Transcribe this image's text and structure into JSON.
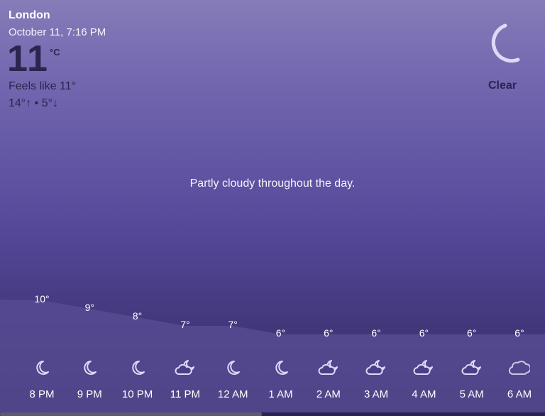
{
  "header": {
    "location": "London",
    "datetime": "October 11, 7:16 PM",
    "temperature": "11",
    "unit": "°C",
    "feels_like": "Feels like 11°",
    "high_low": "14°↑ • 5°↓"
  },
  "condition": {
    "label": "Clear",
    "icon": "crescent-moon-icon"
  },
  "summary": "Partly cloudy throughout the day.",
  "hourly": [
    {
      "time": "8 PM",
      "temp": "10°",
      "value": 10,
      "icon": "moon"
    },
    {
      "time": "9 PM",
      "temp": "9°",
      "value": 9,
      "icon": "moon"
    },
    {
      "time": "10 PM",
      "temp": "8°",
      "value": 8,
      "icon": "moon"
    },
    {
      "time": "11 PM",
      "temp": "7°",
      "value": 7,
      "icon": "moon-cloud"
    },
    {
      "time": "12 AM",
      "temp": "7°",
      "value": 7,
      "icon": "moon"
    },
    {
      "time": "1 AM",
      "temp": "6°",
      "value": 6,
      "icon": "moon"
    },
    {
      "time": "2 AM",
      "temp": "6°",
      "value": 6,
      "icon": "moon-cloud"
    },
    {
      "time": "3 AM",
      "temp": "6°",
      "value": 6,
      "icon": "moon-cloud"
    },
    {
      "time": "4 AM",
      "temp": "6°",
      "value": 6,
      "icon": "moon-cloud"
    },
    {
      "time": "5 AM",
      "temp": "6°",
      "value": 6,
      "icon": "moon-cloud"
    },
    {
      "time": "6 AM",
      "temp": "6°",
      "value": 6,
      "icon": "cloud"
    }
  ],
  "scroll_fraction": 0.48
}
